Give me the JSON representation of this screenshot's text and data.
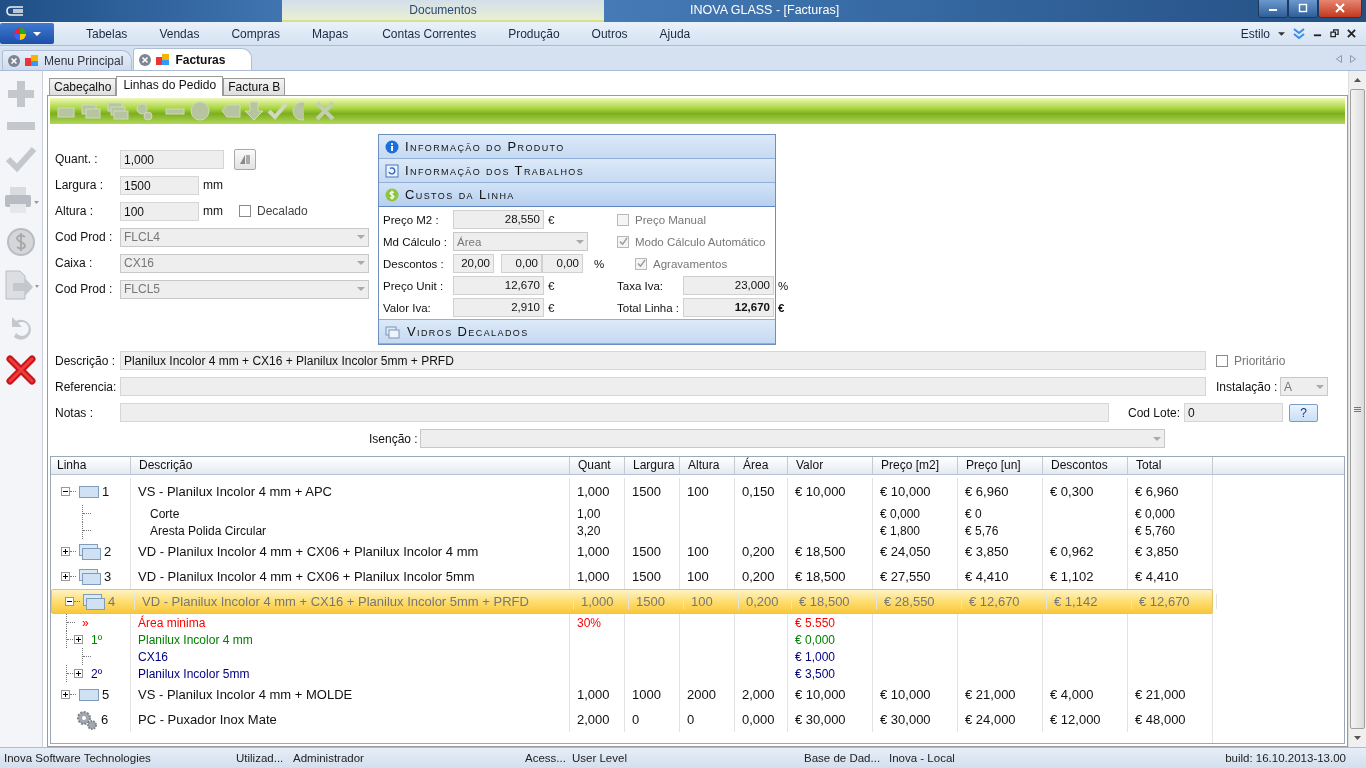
{
  "window": {
    "title": "INOVA GLASS - [Facturas]",
    "context_tab": "Documentos"
  },
  "menu": {
    "items": [
      "Tabelas",
      "Vendas",
      "Compras",
      "Mapas",
      "Contas Correntes",
      "Produção",
      "Outros",
      "Ajuda"
    ],
    "style_label": "Estilo"
  },
  "document_tabs": [
    {
      "label": "Menu Principal",
      "selected": false
    },
    {
      "label": "Facturas",
      "selected": true
    }
  ],
  "form_tabs": [
    {
      "label": "Cabeçalho",
      "selected": false
    },
    {
      "label": "Linhas do Pedido",
      "selected": true
    },
    {
      "label": "Factura B",
      "selected": false
    }
  ],
  "line_fields": [
    {
      "kind": "text",
      "label": "Quant. :",
      "value": "1,000"
    },
    {
      "kind": "text",
      "label": "Largura :",
      "value": "1500",
      "unit": "mm"
    },
    {
      "kind": "text",
      "label": "Altura :",
      "value": "100",
      "unit": "mm"
    },
    {
      "kind": "select",
      "label": "Cod Prod :",
      "value": "FLCL4"
    },
    {
      "kind": "select",
      "label": "Caixa :",
      "value": "CX16"
    },
    {
      "kind": "select",
      "label": "Cod Prod :",
      "value": "FLCL5"
    }
  ],
  "decalado": {
    "label": "Decalado",
    "checked": false
  },
  "sections": [
    {
      "kind": "product",
      "title": "Informação do Produto",
      "expanded": false
    },
    {
      "kind": "jobs",
      "title": "Informação dos Trabalhos",
      "expanded": false
    },
    {
      "kind": "costs",
      "title": "Custos da Linha",
      "expanded": true
    },
    {
      "kind": "glass",
      "title": "Vidros Decalados",
      "expanded": false
    }
  ],
  "costs": {
    "preco_m2": {
      "label": "Preço M2 :",
      "value": "28,550",
      "unit": "€"
    },
    "md_calculo": {
      "label": "Md Cálculo :",
      "value": "Área"
    },
    "descontos": {
      "label": "Descontos :",
      "values": [
        "20,00",
        "0,00",
        "0,00"
      ],
      "unit": "%"
    },
    "preco_unit": {
      "label": "Preço Unit :",
      "value": "12,670",
      "unit": "€"
    },
    "valor_iva": {
      "label": "Valor Iva:",
      "value": "2,910",
      "unit": "€"
    },
    "taxa_iva": {
      "label": "Taxa Iva:",
      "value": "23,000",
      "unit": "%"
    },
    "total_linha": {
      "label": "Total Linha :",
      "value": "12,670",
      "unit": "€"
    },
    "options": [
      {
        "label": "Preço Manual",
        "checked": false,
        "disabled": true
      },
      {
        "label": "Modo Cálculo Automático",
        "checked": true,
        "disabled": true
      },
      {
        "label": "Agravamentos",
        "checked": true,
        "disabled": true
      }
    ]
  },
  "details": {
    "descricao": {
      "label": "Descrição :",
      "value": "Planilux Incolor 4 mm + CX16 + Planilux Incolor 5mm + PRFD"
    },
    "prioritario": {
      "label": "Prioritário",
      "checked": false
    },
    "referencia": {
      "label": "Referencia:"
    },
    "instalacao": {
      "label": "Instalação :",
      "value": "A"
    },
    "notas": {
      "label": "Notas :"
    },
    "cod_lote": {
      "label": "Cod Lote:",
      "value": "0"
    },
    "help_button": "?",
    "isencao": {
      "label": "Isenção :"
    }
  },
  "table": {
    "columns": [
      "Linha",
      "Descrição",
      "Quant",
      "Largura",
      "Altura",
      "Área",
      "Valor",
      "Preço [m2]",
      "Preço [un]",
      "Descontos",
      "Total"
    ],
    "rows": [
      {
        "linha": "1",
        "kind": "single_glass",
        "expanded": true,
        "selected": false,
        "descricao": "VS - Planilux Incolor 4 mm + APC",
        "quant": "1,000",
        "largura": "1500",
        "altura": "100",
        "area": "0,150",
        "valor": "€ 10,000",
        "preco_m2": "€ 10,000",
        "preco_un": "€ 6,960",
        "descontos": "€ 0,300",
        "total": "€ 6,960",
        "children": [
          {
            "descricao": "Corte",
            "quant": "1,00",
            "preco_m2": "€ 0,000",
            "preco_un": "€ 0",
            "total": "€ 0,000"
          },
          {
            "descricao": "Aresta Polida Circular",
            "quant": "3,20",
            "preco_m2": "€ 1,800",
            "preco_un": "€ 5,76",
            "total": "€ 5,760"
          }
        ]
      },
      {
        "linha": "2",
        "kind": "double_glass",
        "expanded": false,
        "selected": false,
        "descricao": "VD - Planilux Incolor 4 mm + CX06 + Planilux Incolor 4 mm",
        "quant": "1,000",
        "largura": "1500",
        "altura": "100",
        "area": "0,200",
        "valor": "€ 18,500",
        "preco_m2": "€ 24,050",
        "preco_un": "€ 3,850",
        "descontos": "€ 0,962",
        "total": "€ 3,850"
      },
      {
        "linha": "3",
        "kind": "double_glass",
        "expanded": false,
        "selected": false,
        "descricao": "VD - Planilux Incolor 4 mm + CX06 + Planilux Incolor 5mm",
        "quant": "1,000",
        "largura": "1500",
        "altura": "100",
        "area": "0,200",
        "valor": "€ 18,500",
        "preco_m2": "€ 27,550",
        "preco_un": "€ 4,410",
        "descontos": "€ 1,102",
        "total": "€ 4,410"
      },
      {
        "linha": "4",
        "kind": "double_glass",
        "expanded": true,
        "selected": true,
        "descricao": "VD - Planilux Incolor 4 mm + CX16 + Planilux Incolor 5mm + PRFD",
        "quant": "1,000",
        "largura": "1500",
        "altura": "100",
        "area": "0,200",
        "valor": "€ 18,500",
        "preco_m2": "€ 28,550",
        "preco_un": "€ 12,670",
        "descontos": "€ 1,142",
        "total": "€ 12,670",
        "children": [
          {
            "marker": "»",
            "color": "#ff0000",
            "descricao": "Área minima",
            "quant": "30%",
            "valor": "€ 5.550"
          },
          {
            "marker": "1º",
            "color": "#008000",
            "expanded": false,
            "descricao": "Planilux Incolor 4 mm",
            "valor": "€ 0,000"
          },
          {
            "color": "#000080",
            "descricao": "CX16",
            "valor": "€ 1,000"
          },
          {
            "marker": "2º",
            "color": "#000080",
            "expanded": false,
            "descricao": "Planilux Incolor 5mm",
            "valor": "€ 3,500"
          }
        ]
      },
      {
        "linha": "5",
        "kind": "single_glass",
        "expanded": false,
        "selected": false,
        "descricao": "VS - Planilux Incolor 4 mm + MOLDE",
        "quant": "1,000",
        "largura": "1000",
        "altura": "2000",
        "area": "2,000",
        "valor": "€ 10,000",
        "preco_m2": "€ 10,000",
        "preco_un": "€ 21,000",
        "descontos": "€ 4,000",
        "total": "€ 21,000"
      },
      {
        "linha": "6",
        "kind": "gears",
        "selected": false,
        "descricao": "PC - Puxador Inox Mate",
        "quant": "2,000",
        "largura": "0",
        "altura": "0",
        "area": "0,000",
        "valor": "€ 30,000",
        "preco_m2": "€ 30,000",
        "preco_un": "€ 24,000",
        "descontos": "€ 12,000",
        "total": "€ 48,000"
      }
    ]
  },
  "status_bar": [
    "Inova Software Technologies",
    "Utilizad...",
    "Administrador",
    "Acess...",
    "User Level",
    "Base de Dad...",
    "Inova - Local",
    "build: 16.10.2013-13.00"
  ]
}
